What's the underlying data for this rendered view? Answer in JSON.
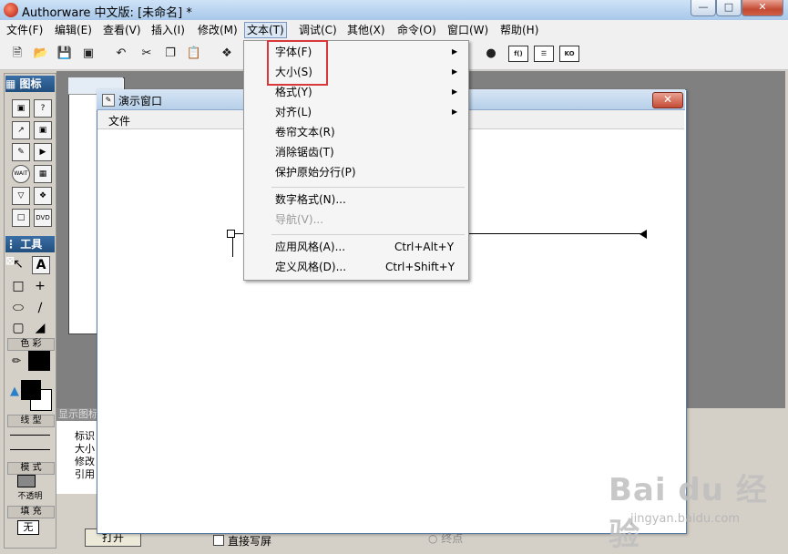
{
  "window": {
    "title": "Authorware 中文版: [未命名] *"
  },
  "menubar": [
    {
      "label": "文件(F)"
    },
    {
      "label": "编辑(E)"
    },
    {
      "label": "查看(V)"
    },
    {
      "label": "插入(I)"
    },
    {
      "label": "修改(M)"
    },
    {
      "label": "文本(T)"
    },
    {
      "label": "调试(C)"
    },
    {
      "label": "其他(X)"
    },
    {
      "label": "命令(O)"
    },
    {
      "label": "窗口(W)"
    },
    {
      "label": "帮助(H)"
    }
  ],
  "text_menu": {
    "items": [
      {
        "label": "字体(F)",
        "submenu": true
      },
      {
        "label": "大小(S)",
        "submenu": true
      },
      {
        "label": "格式(Y)",
        "submenu": true
      },
      {
        "label": "对齐(L)",
        "submenu": true
      },
      {
        "label": "卷帘文本(R)"
      },
      {
        "label": "消除锯齿(T)"
      },
      {
        "label": "保护原始分行(P)"
      },
      {
        "label": "数字格式(N)..."
      },
      {
        "label": "导航(V)...",
        "disabled": true
      },
      {
        "label": "应用风格(A)...",
        "shortcut": "Ctrl+Alt+Y"
      },
      {
        "label": "定义风格(D)...",
        "shortcut": "Ctrl+Shift+Y"
      }
    ],
    "highlight_color": "#d9383a"
  },
  "palette": {
    "icons_title": "图标",
    "tools_title": "工具",
    "color_label": "色 彩",
    "line_label": "线 型",
    "mode_label": "模 式",
    "mode_value": "不透明",
    "fill_label": "填 充",
    "fill_value": "无"
  },
  "presentation": {
    "title": "演示窗口",
    "menu_file": "文件"
  },
  "bottom": {
    "header": "显示图标",
    "props": [
      "标识",
      "大小",
      "修改",
      "引用"
    ],
    "open_button": "打开",
    "direct_label": "直接写屏",
    "endpoint_label": "终点"
  },
  "watermark": {
    "text": "Bai du 经验",
    "sub": "jingyan.baidu.com"
  }
}
